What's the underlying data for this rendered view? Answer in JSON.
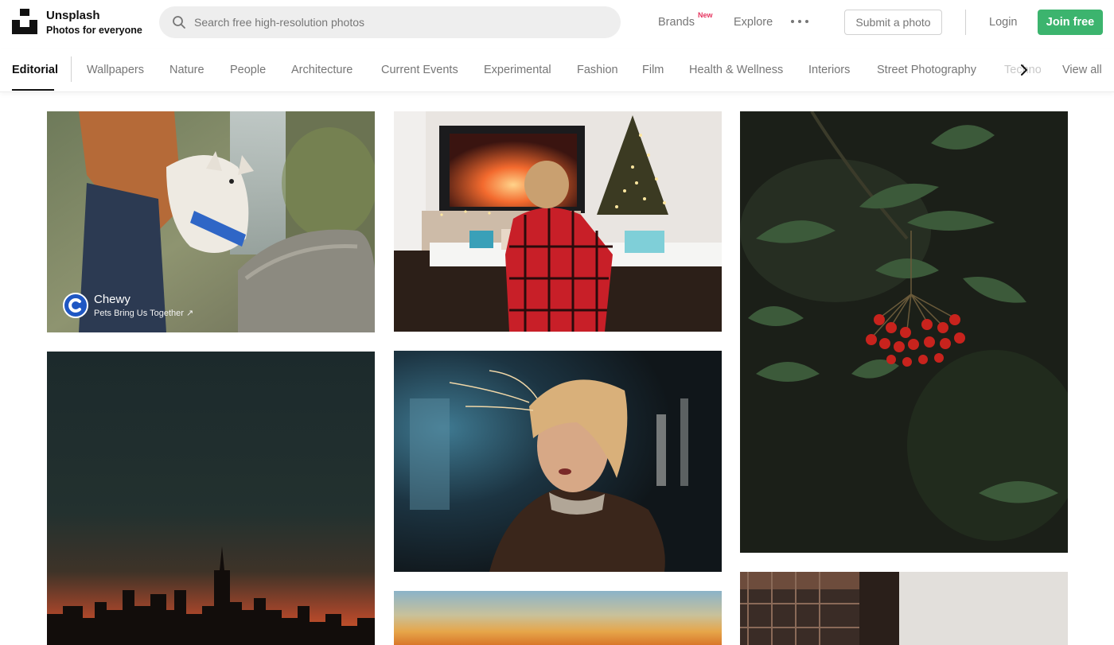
{
  "header": {
    "logo_name": "Unsplash",
    "logo_tagline": "Photos for everyone",
    "search_placeholder": "Search free high-resolution photos",
    "brands_label": "Brands",
    "brands_badge": "New",
    "explore_label": "Explore",
    "submit_label": "Submit a photo",
    "login_label": "Login",
    "join_label": "Join free"
  },
  "topics": {
    "items": [
      "Editorial",
      "Wallpapers",
      "Nature",
      "People",
      "Architecture",
      "Current Events",
      "Experimental",
      "Fashion",
      "Film",
      "Health & Wellness",
      "Interiors",
      "Street Photography",
      "Technology"
    ],
    "active": "Editorial",
    "view_all": "View all"
  },
  "sponsored": {
    "name": "Chewy",
    "tagline": "Pets Bring Us Together ↗"
  },
  "colors": {
    "accent": "#3cb46e",
    "badge": "#e6345f",
    "muted_text": "#767676"
  }
}
